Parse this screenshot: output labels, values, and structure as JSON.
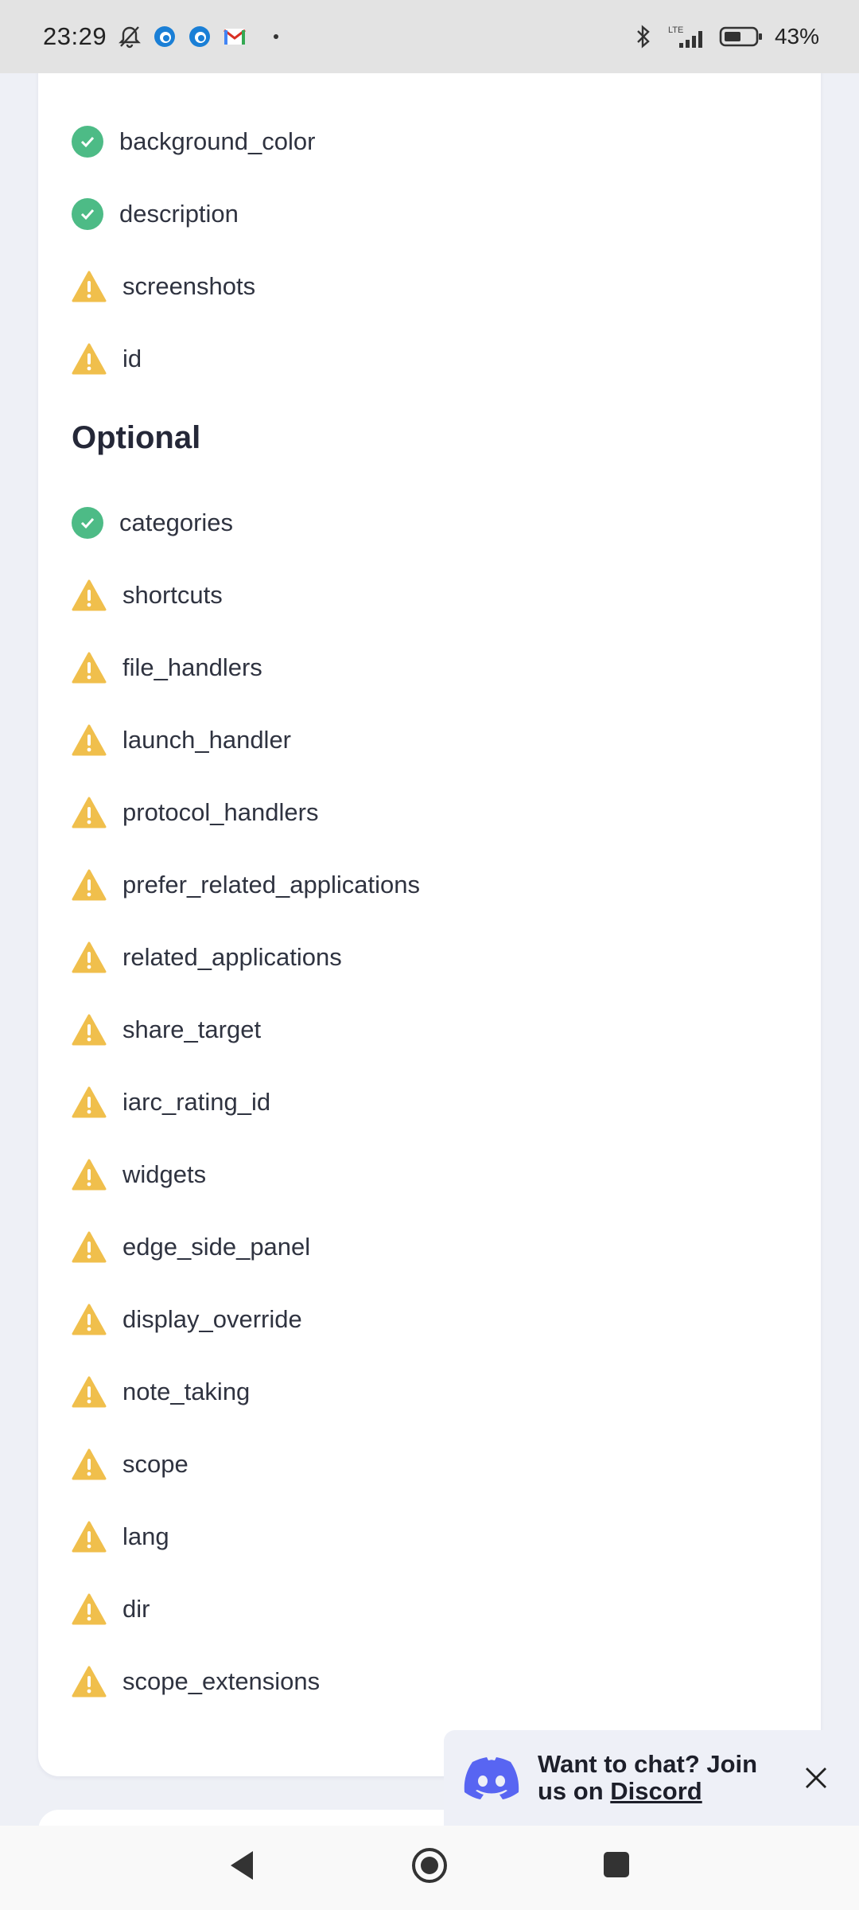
{
  "status_bar": {
    "time": "23:29",
    "left_icons": [
      "bell-off-icon",
      "edge-icon",
      "edge-icon",
      "gmail-icon"
    ],
    "right_icons": [
      "bluetooth-icon",
      "lte-signal-icon",
      "battery-icon"
    ],
    "network_label": "LTE",
    "battery_percent": "43%"
  },
  "required": {
    "items": [
      {
        "label": "background_color",
        "status": "ok"
      },
      {
        "label": "description",
        "status": "ok"
      },
      {
        "label": "screenshots",
        "status": "warning"
      },
      {
        "label": "id",
        "status": "warning"
      }
    ]
  },
  "optional": {
    "title": "Optional",
    "items": [
      {
        "label": "categories",
        "status": "ok"
      },
      {
        "label": "shortcuts",
        "status": "warning"
      },
      {
        "label": "file_handlers",
        "status": "warning"
      },
      {
        "label": "launch_handler",
        "status": "warning"
      },
      {
        "label": "protocol_handlers",
        "status": "warning"
      },
      {
        "label": "prefer_related_applications",
        "status": "warning"
      },
      {
        "label": "related_applications",
        "status": "warning"
      },
      {
        "label": "share_target",
        "status": "warning"
      },
      {
        "label": "iarc_rating_id",
        "status": "warning"
      },
      {
        "label": "widgets",
        "status": "warning"
      },
      {
        "label": "edge_side_panel",
        "status": "warning"
      },
      {
        "label": "display_override",
        "status": "warning"
      },
      {
        "label": "note_taking",
        "status": "warning"
      },
      {
        "label": "scope",
        "status": "warning"
      },
      {
        "label": "lang",
        "status": "warning"
      },
      {
        "label": "dir",
        "status": "warning"
      },
      {
        "label": "scope_extensions",
        "status": "warning"
      }
    ]
  },
  "toast": {
    "text_before": "Want to chat? Join us on ",
    "link": "Discord",
    "icon": "discord-icon",
    "close_icon": "close-icon"
  },
  "navigation": {
    "buttons": [
      "back-icon",
      "home-icon",
      "recents-icon"
    ]
  },
  "colors": {
    "ok": "#4dbb86",
    "warning": "#f0bf4c",
    "discord": "#5865f2"
  }
}
